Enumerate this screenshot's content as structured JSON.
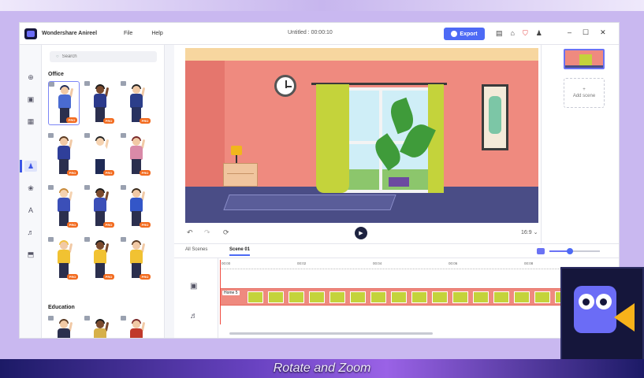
{
  "app": {
    "name": "Wondershare Anireel",
    "doc_title": "Untitled : 00:00:10"
  },
  "menu": [
    {
      "label": "File"
    },
    {
      "label": "Help"
    }
  ],
  "toolbar": {
    "export_label": "Export"
  },
  "icons": {
    "rail": [
      "home-icon",
      "media-icon",
      "scene-icon",
      "character-icon",
      "prop-icon",
      "text-icon",
      "music-icon",
      "import-icon"
    ],
    "titlebar": [
      "save-icon",
      "share-icon",
      "cart-icon",
      "account-icon"
    ],
    "window_controls": [
      "minimize-icon",
      "maximize-icon",
      "close-icon"
    ]
  },
  "panel": {
    "search_placeholder": "Search",
    "sections": [
      {
        "title": "Office"
      },
      {
        "title": "Education"
      }
    ],
    "badge": "PRO"
  },
  "canvas": {
    "aspect_ratio": "16:9"
  },
  "scenes": {
    "add_label": "Add scene"
  },
  "timeline": {
    "tabs": [
      {
        "label": "All Scenes"
      },
      {
        "label": "Scene 01"
      }
    ],
    "ruler": [
      "00:00",
      "00:02",
      "00:04",
      "00:06",
      "00:08"
    ],
    "clip_label": "Home 5",
    "zoom_level": 0.4
  },
  "caption": "Rotate and Zoom",
  "colors": {
    "accent": "#4d6af5",
    "pro_badge": "#f26b1f",
    "wall": "#ef8a7f",
    "floor": "#4a4d86"
  }
}
